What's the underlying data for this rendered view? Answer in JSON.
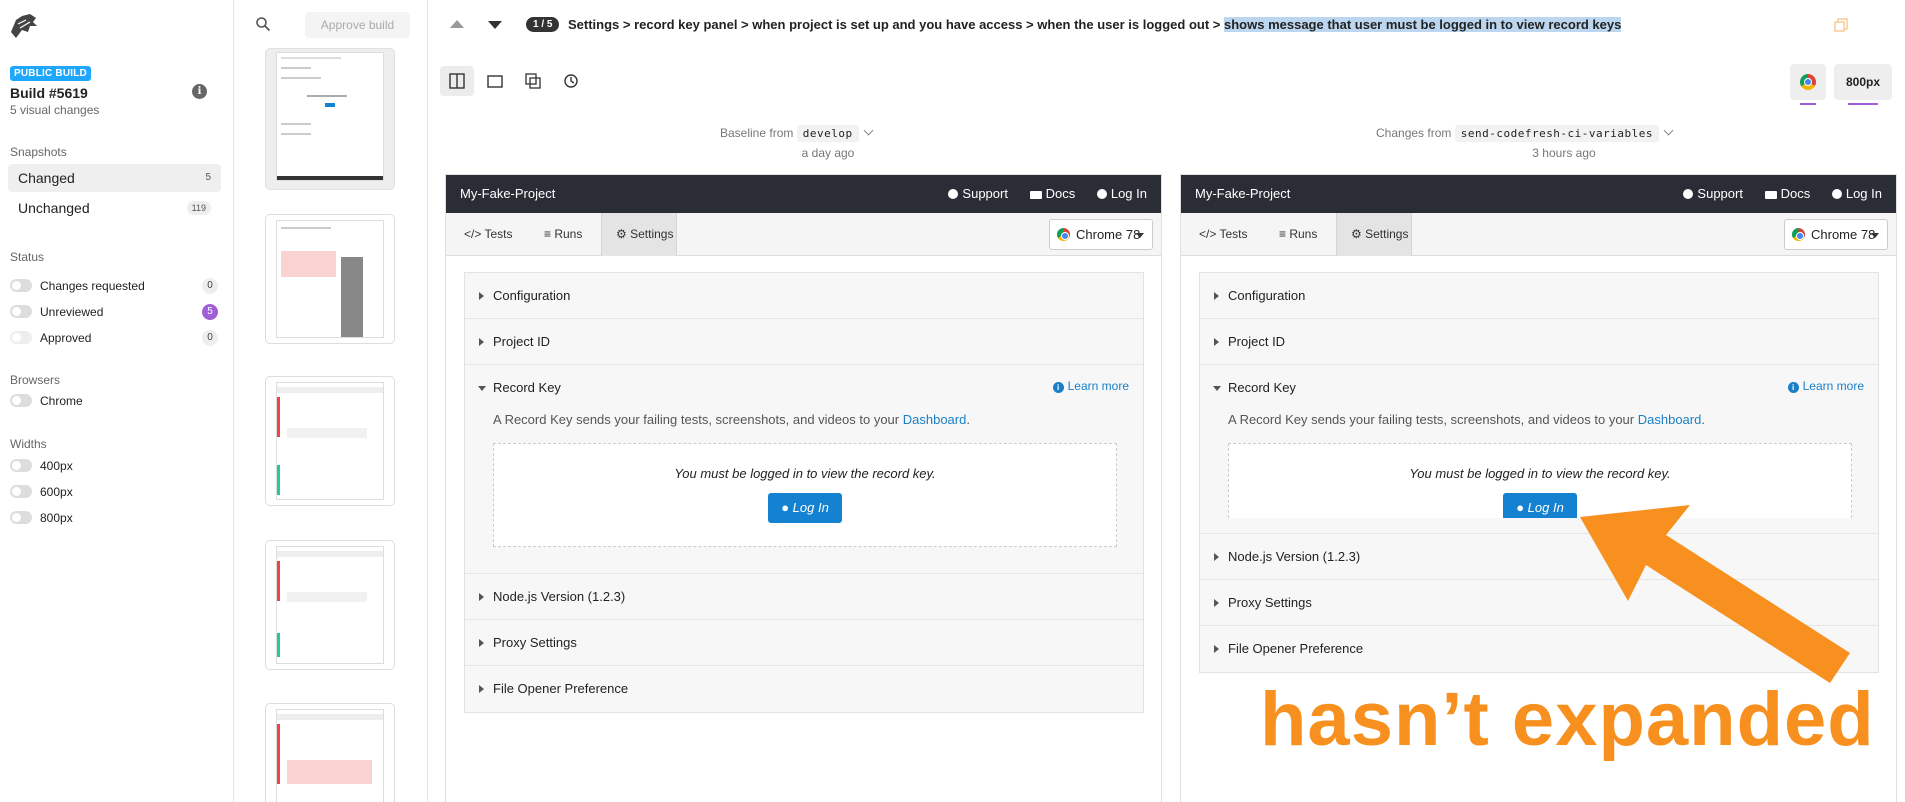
{
  "sidebar": {
    "build_badge": "PUBLIC BUILD",
    "build_title": "Build #5619",
    "build_subtitle": "5 visual changes",
    "snapshots_heading": "Snapshots",
    "snapshots": [
      {
        "label": "Changed",
        "count": "5"
      },
      {
        "label": "Unchanged",
        "count": "119"
      }
    ],
    "status_heading": "Status",
    "status": [
      {
        "label": "Changes requested",
        "count": "0"
      },
      {
        "label": "Unreviewed",
        "count": "5"
      },
      {
        "label": "Approved",
        "count": "0"
      }
    ],
    "browsers_heading": "Browsers",
    "browsers": [
      {
        "label": "Chrome"
      }
    ],
    "widths_heading": "Widths",
    "widths": [
      {
        "label": "400px"
      },
      {
        "label": "600px"
      },
      {
        "label": "800px"
      }
    ]
  },
  "thumbs": {
    "approve_label": "Approve build"
  },
  "header": {
    "counter": "1 / 5",
    "breadcrumb": "Settings > record key panel > when project is set up and you have access > when the user is logged out >",
    "breadcrumb_highlight": "shows message that user must be logged in to view record keys",
    "width_label": "800px"
  },
  "baseline": {
    "prefix": "Baseline from",
    "branch": "develop",
    "ago": "a day ago"
  },
  "changes": {
    "prefix": "Changes from",
    "branch": "send-codefresh-ci-variables",
    "ago": "3 hours ago"
  },
  "snapshot": {
    "project": "My-Fake-Project",
    "nav": {
      "support": "Support",
      "docs": "Docs",
      "login": "Log In"
    },
    "tabs": {
      "tests": "Tests",
      "runs": "Runs",
      "settings": "Settings"
    },
    "browser": "Chrome 78",
    "sections": {
      "configuration": "Configuration",
      "project_id": "Project ID",
      "record_key": "Record Key",
      "learn_more": "Learn more",
      "description": "A Record Key sends your failing tests, screenshots, and videos to your",
      "dashboard_link": "Dashboard",
      "period": ".",
      "login_message": "You must be logged in to view the record key.",
      "login_button": "Log In",
      "node_version": "Node.js Version (1.2.3)",
      "proxy": "Proxy Settings",
      "file_opener": "File Opener Preference"
    }
  },
  "annotation": {
    "text": "hasn’t expanded",
    "color": "#f7901e"
  },
  "colors": {
    "accent_purple": "#a15fd6",
    "link_blue": "#1a7fc5",
    "nav_dark": "#2a2d35"
  }
}
